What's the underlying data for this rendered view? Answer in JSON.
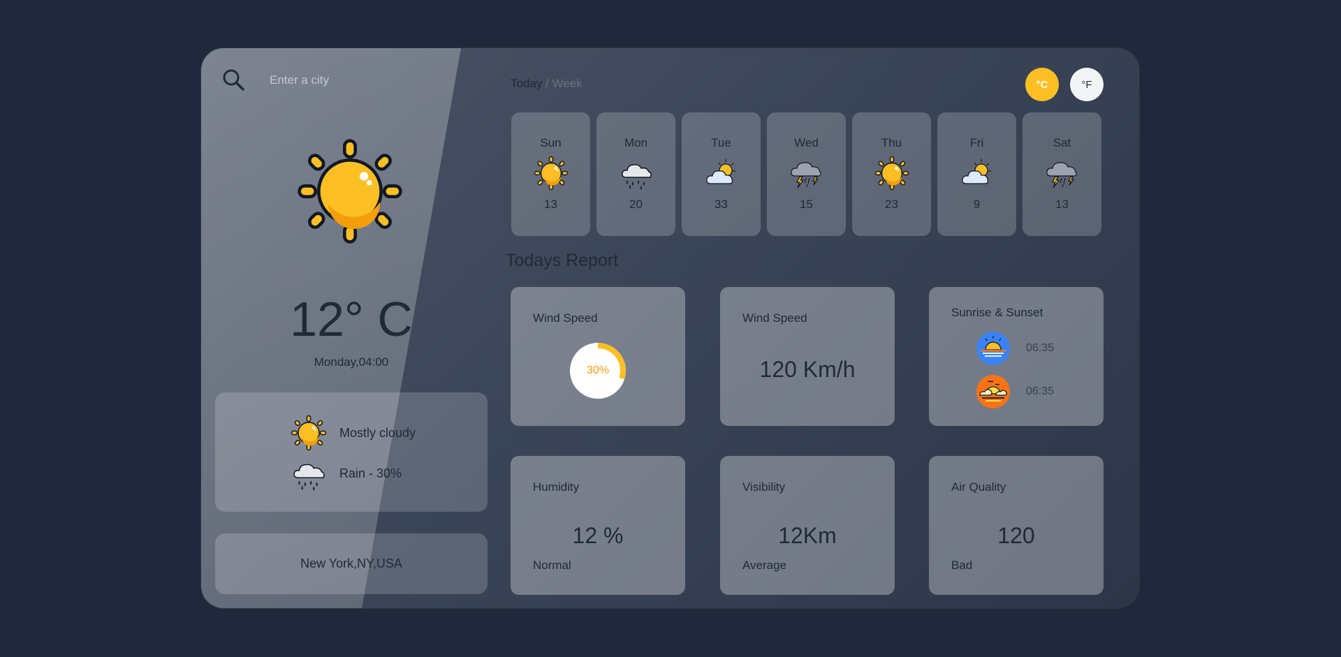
{
  "search": {
    "placeholder": "Enter a city",
    "icon": "search-icon"
  },
  "current": {
    "temperature": "12° C",
    "datetime": "Monday,04:00",
    "icon": "sun-icon",
    "conditions": [
      {
        "icon": "sun-icon",
        "label": "Mostly cloudy"
      },
      {
        "icon": "rain-cloud-icon",
        "label": "Rain - 30%"
      }
    ],
    "location": "New York,NY,USA"
  },
  "period": {
    "today": "Today",
    "separator": " / ",
    "week": "Week"
  },
  "units": {
    "celsius": "°C",
    "fahrenheit": "°F",
    "active": "celsius"
  },
  "colors": {
    "accent": "#fbbf24",
    "background": "#1f293b"
  },
  "forecast": [
    {
      "day": "Sun",
      "icon": "sun-icon",
      "temp": "13"
    },
    {
      "day": "Mon",
      "icon": "rain-cloud-icon",
      "temp": "20"
    },
    {
      "day": "Tue",
      "icon": "partly-cloudy-icon",
      "temp": "33"
    },
    {
      "day": "Wed",
      "icon": "thunderstorm-icon",
      "temp": "15"
    },
    {
      "day": "Thu",
      "icon": "sun-icon",
      "temp": "23"
    },
    {
      "day": "Fri",
      "icon": "partly-cloudy-icon",
      "temp": "9"
    },
    {
      "day": "Sat",
      "icon": "thunderstorm-icon",
      "temp": "13"
    }
  ],
  "report": {
    "title": "Todays Report",
    "wind_gauge": {
      "title": "Wind Speed",
      "value_label": "30%",
      "fraction": 0.3
    },
    "wind_speed": {
      "title": "Wind Speed",
      "value": "120 Km/h"
    },
    "sun": {
      "title": "Sunrise & Sunset",
      "sunrise": "06:35",
      "sunset": "06:35"
    },
    "humidity": {
      "title": "Humidity",
      "value": "12 %",
      "note": "Normal"
    },
    "visibility": {
      "title": "Visibility",
      "value": "12Km",
      "note": "Average"
    },
    "air_quality": {
      "title": "Air Quality",
      "value": "120",
      "note": "Bad"
    }
  }
}
